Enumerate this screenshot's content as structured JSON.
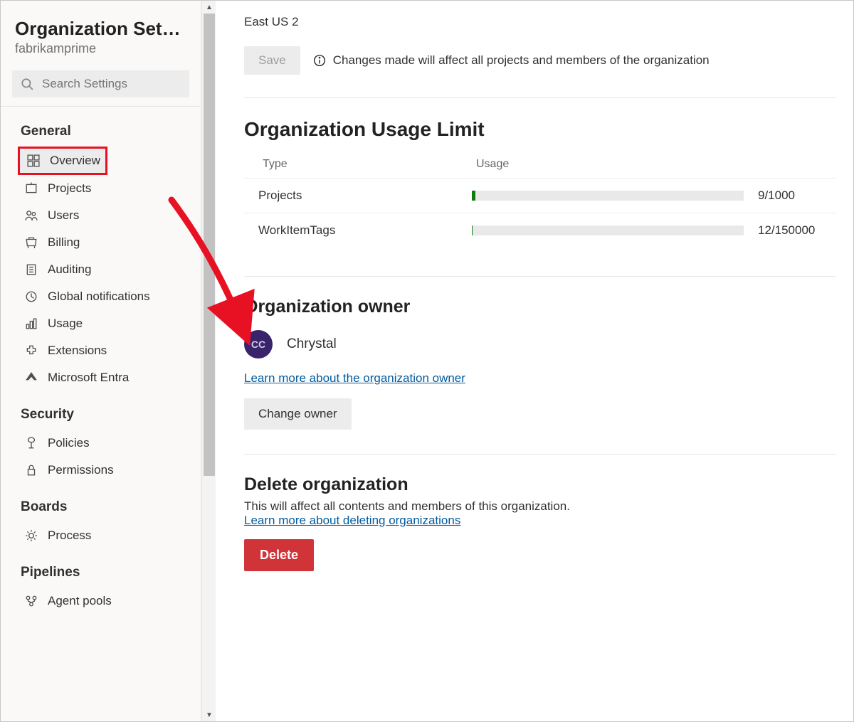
{
  "sidebar": {
    "title": "Organization Settin...",
    "subtitle": "fabrikamprime",
    "search_placeholder": "Search Settings",
    "groups": [
      {
        "title": "General",
        "items": [
          {
            "label": "Overview",
            "icon": "overview",
            "active": true,
            "highlighted": true
          },
          {
            "label": "Projects",
            "icon": "projects"
          },
          {
            "label": "Users",
            "icon": "users"
          },
          {
            "label": "Billing",
            "icon": "billing"
          },
          {
            "label": "Auditing",
            "icon": "auditing"
          },
          {
            "label": "Global notifications",
            "icon": "notification"
          },
          {
            "label": "Usage",
            "icon": "usage"
          },
          {
            "label": "Extensions",
            "icon": "extensions"
          },
          {
            "label": "Microsoft Entra",
            "icon": "entra"
          }
        ]
      },
      {
        "title": "Security",
        "items": [
          {
            "label": "Policies",
            "icon": "policies"
          },
          {
            "label": "Permissions",
            "icon": "permissions"
          }
        ]
      },
      {
        "title": "Boards",
        "items": [
          {
            "label": "Process",
            "icon": "process"
          }
        ]
      },
      {
        "title": "Pipelines",
        "items": [
          {
            "label": "Agent pools",
            "icon": "agent-pools"
          }
        ]
      }
    ]
  },
  "main": {
    "region": "East US 2",
    "save_label": "Save",
    "save_note": "Changes made will affect all projects and members of the organization",
    "usage": {
      "heading": "Organization Usage Limit",
      "col_type": "Type",
      "col_usage": "Usage",
      "rows": [
        {
          "type": "Projects",
          "used": 9,
          "limit": 1000,
          "display": "9/1000"
        },
        {
          "type": "WorkItemTags",
          "used": 12,
          "limit": 150000,
          "display": "12/150000"
        }
      ]
    },
    "owner": {
      "heading": "Organization owner",
      "avatar_initials": "CC",
      "name": "Chrystal",
      "learn_more": "Learn more about the organization owner",
      "change_label": "Change owner"
    },
    "delete": {
      "heading": "Delete organization",
      "description": "This will affect all contents and members of this organization.",
      "learn_more": "Learn more about deleting organizations",
      "button_label": "Delete"
    }
  },
  "annotation": {
    "arrow_color": "#e81123"
  }
}
